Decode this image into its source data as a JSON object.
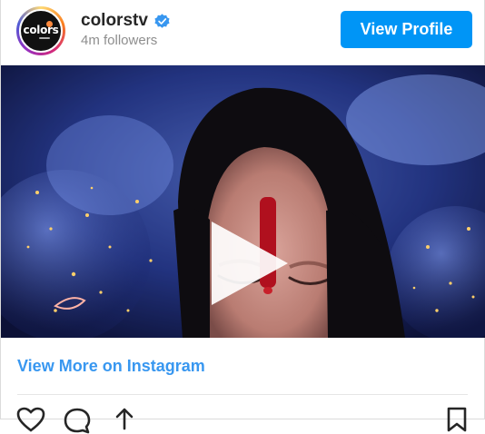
{
  "account": {
    "avatar_text": "colors",
    "username": "colorstv",
    "followers": "4m followers"
  },
  "actions": {
    "view_profile_label": "View Profile"
  },
  "footer": {
    "more_link": "View More on Instagram"
  },
  "icons": {
    "verified": "verified-badge-icon",
    "play": "play-icon",
    "like": "heart-icon",
    "comment": "comment-icon",
    "share": "share-icon",
    "save": "bookmark-icon"
  },
  "colors": {
    "accent": "#0095f6",
    "link": "#3897f0",
    "text": "#262626",
    "muted": "#8e8e8e"
  }
}
